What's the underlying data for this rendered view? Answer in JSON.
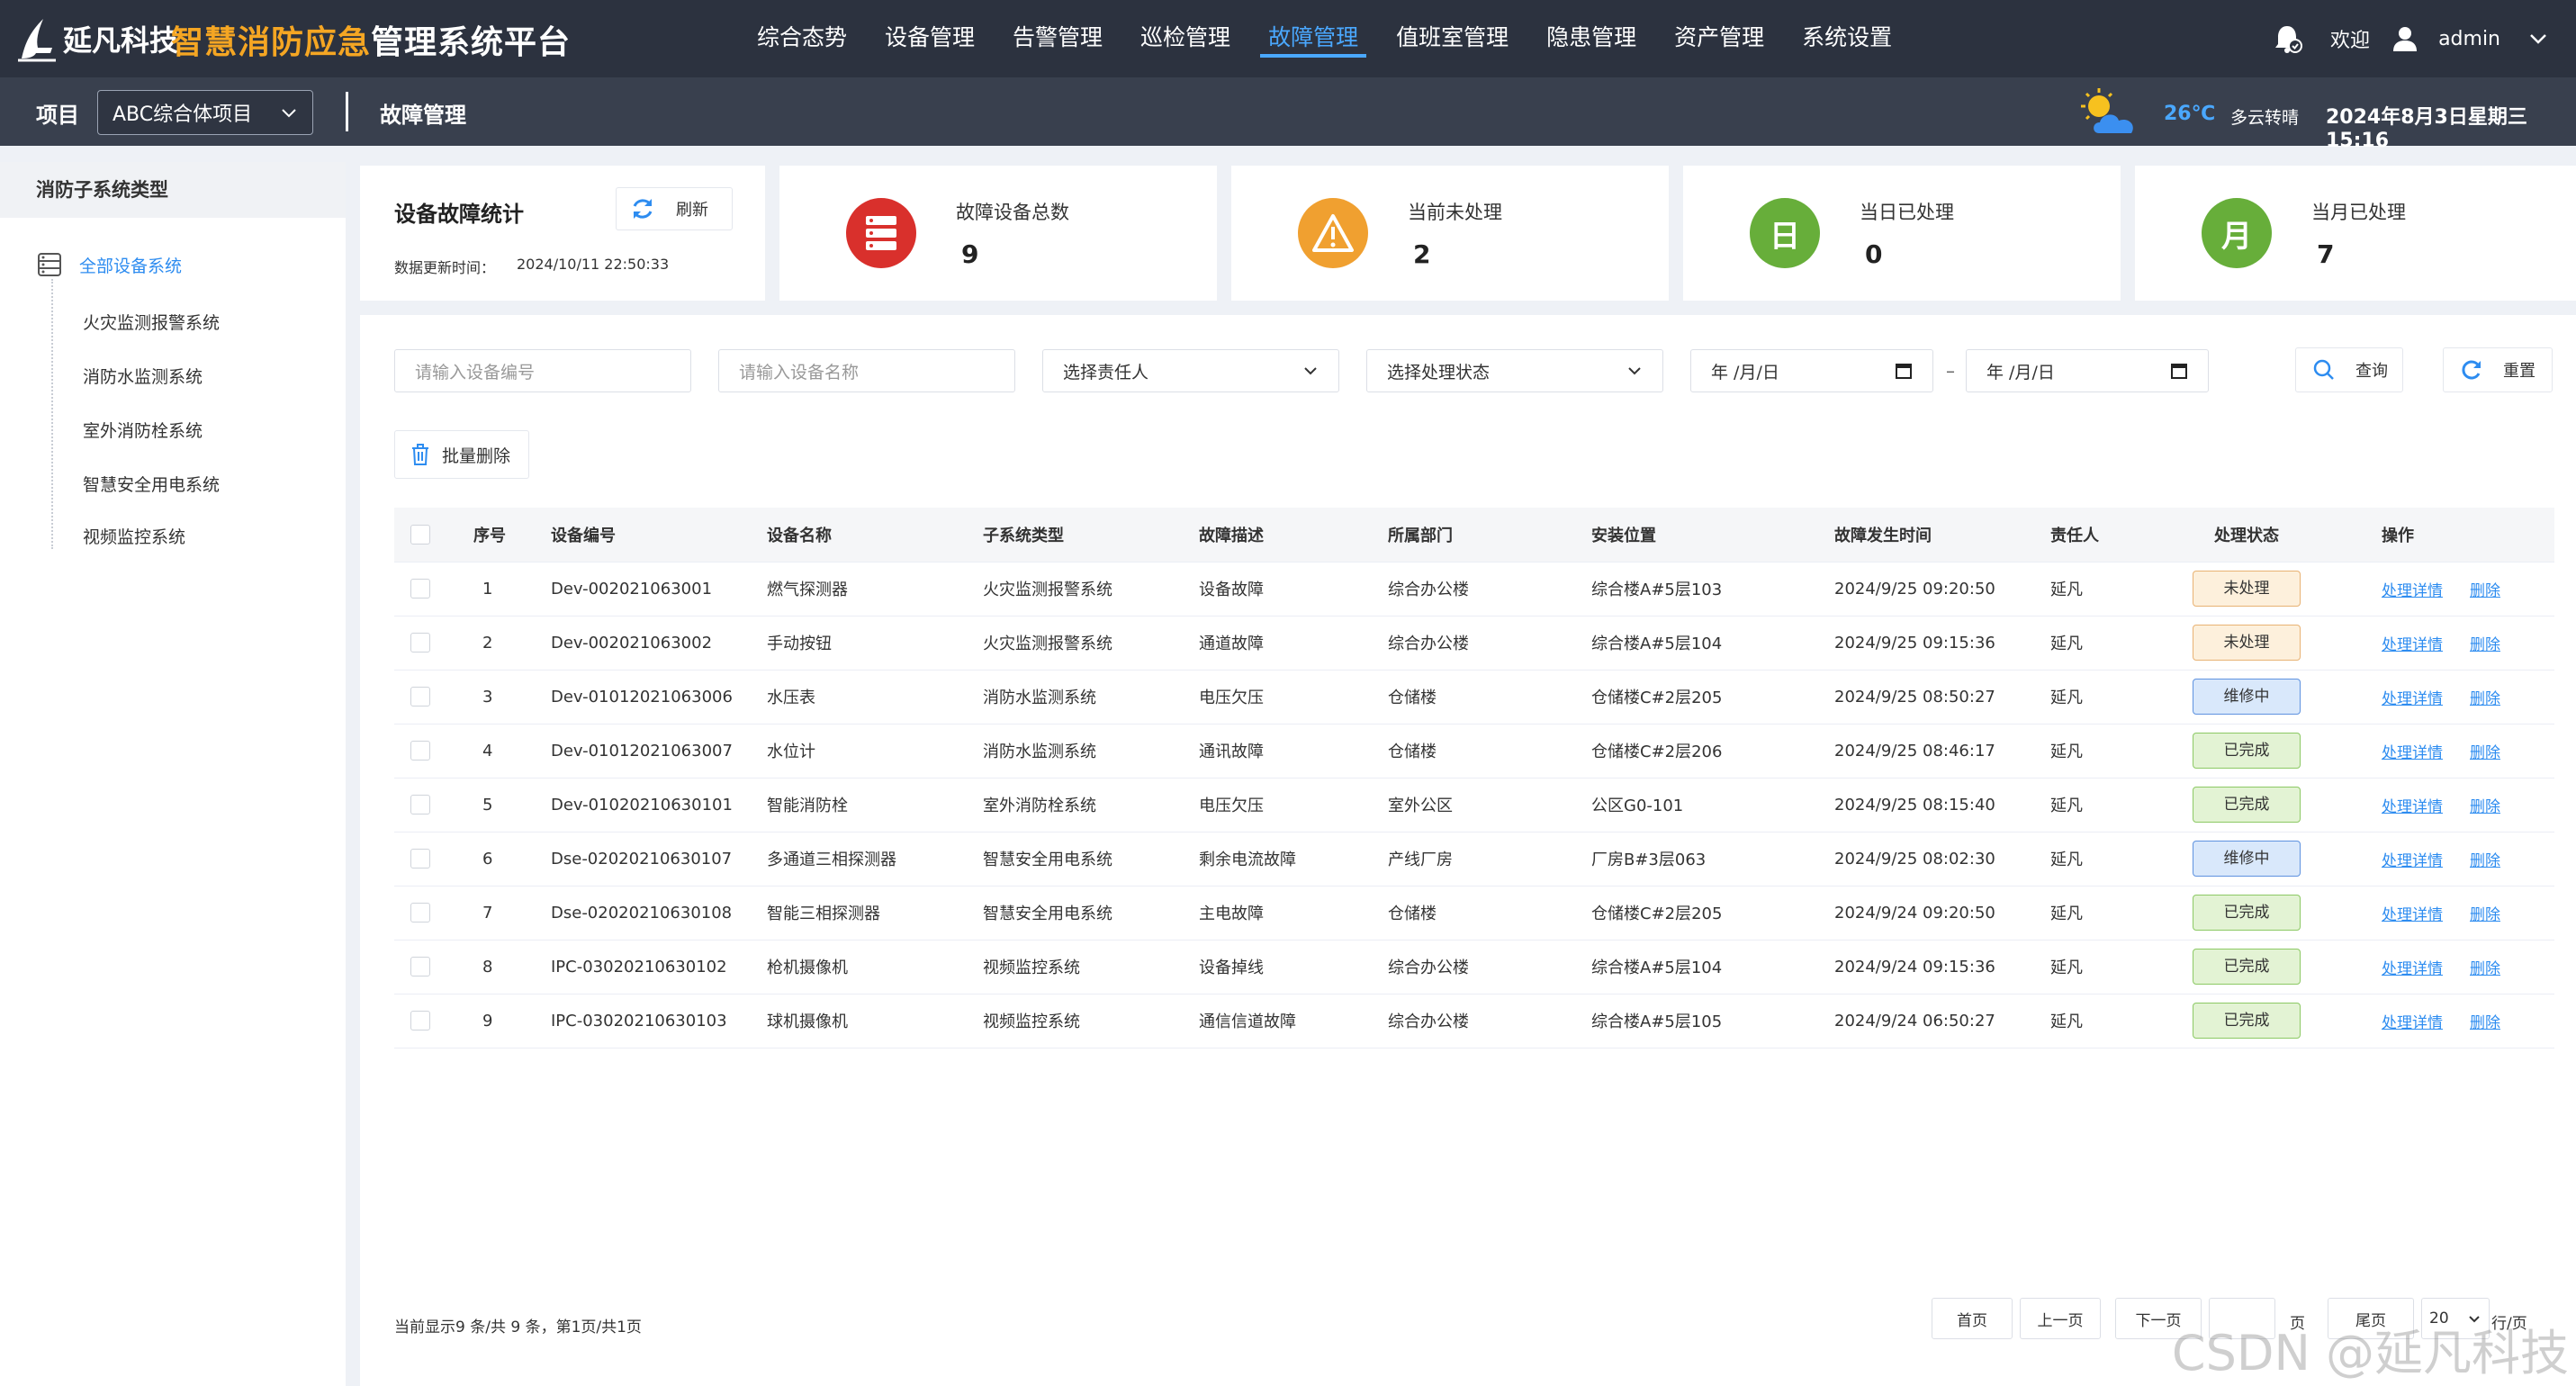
{
  "header": {
    "brand": "延凡科技",
    "system_title_highlight": "智慧消防应急",
    "system_title_rest": "管理系统平台",
    "nav": [
      "综合态势",
      "设备管理",
      "告警管理",
      "巡检管理",
      "故障管理",
      "值班室管理",
      "隐患管理",
      "资产管理",
      "系统设置"
    ],
    "active_nav": "故障管理",
    "welcome": "欢迎",
    "username": "admin"
  },
  "subbar": {
    "project_label": "项目",
    "project_value": "ABC综合体项目",
    "page_label": "故障管理",
    "temperature": "26℃",
    "weather": "多云转晴",
    "datetime": "2024年8月3日星期三 15:16"
  },
  "sidebar": {
    "title": "消防子系统类型",
    "root": "全部设备系统",
    "items": [
      "火灾监测报警系统",
      "消防水监测系统",
      "室外消防栓系统",
      "智慧安全用电系统",
      "视频监控系统"
    ]
  },
  "stats": {
    "title": "设备故障统计",
    "refresh_label": "刷新",
    "update_label": "数据更新时间：",
    "update_time": "2024/10/11 22:50:33",
    "cards": [
      {
        "label": "故障设备总数",
        "value": "9",
        "color": "#d9302c",
        "icon": "server-icon"
      },
      {
        "label": "当前未处理",
        "value": "2",
        "color": "#f0a030",
        "icon": "warning-icon"
      },
      {
        "label": "当日已处理",
        "value": "0",
        "color": "#67ae3a",
        "icon_text": "日"
      },
      {
        "label": "当月已处理",
        "value": "7",
        "color": "#67ae3a",
        "icon_text": "月"
      }
    ]
  },
  "filters": {
    "device_code_placeholder": "请输入设备编号",
    "device_name_placeholder": "请输入设备名称",
    "owner_select": "选择责任人",
    "status_select": "选择处理状态",
    "date_start": "年 /月/日",
    "date_end": "年 /月/日",
    "date_sep": "–",
    "query_label": "查询",
    "reset_label": "重置",
    "batch_delete_label": "批量删除"
  },
  "table": {
    "columns": [
      "序号",
      "设备编号",
      "设备名称",
      "子系统类型",
      "故障描述",
      "所属部门",
      "安装位置",
      "故障发生时间",
      "责任人",
      "处理状态",
      "操作"
    ],
    "detail_label": "处理详情",
    "delete_label": "删除",
    "rows": [
      {
        "no": "1",
        "code": "Dev-002021063001",
        "name": "燃气探测器",
        "subsystem": "火灾监测报警系统",
        "fault": "设备故障",
        "dept": "综合办公楼",
        "location": "综合楼A#5层103",
        "time": "2024/9/25 09:20:50",
        "owner": "延凡",
        "status": "未处理",
        "status_type": "pending"
      },
      {
        "no": "2",
        "code": "Dev-002021063002",
        "name": "手动按钮",
        "subsystem": "火灾监测报警系统",
        "fault": "通道故障",
        "dept": "综合办公楼",
        "location": "综合楼A#5层104",
        "time": "2024/9/25 09:15:36",
        "owner": "延凡",
        "status": "未处理",
        "status_type": "pending"
      },
      {
        "no": "3",
        "code": "Dev-01012021063006",
        "name": "水压表",
        "subsystem": "消防水监测系统",
        "fault": "电压欠压",
        "dept": "仓储楼",
        "location": "仓储楼C#2层205",
        "time": "2024/9/25 08:50:27",
        "owner": "延凡",
        "status": "维修中",
        "status_type": "repair"
      },
      {
        "no": "4",
        "code": "Dev-01012021063007",
        "name": "水位计",
        "subsystem": "消防水监测系统",
        "fault": "通讯故障",
        "dept": "仓储楼",
        "location": "仓储楼C#2层206",
        "time": "2024/9/25 08:46:17",
        "owner": "延凡",
        "status": "已完成",
        "status_type": "done"
      },
      {
        "no": "5",
        "code": "Dev-01020210630101",
        "name": "智能消防栓",
        "subsystem": "室外消防栓系统",
        "fault": "电压欠压",
        "dept": "室外公区",
        "location": "公区G0-101",
        "time": "2024/9/25 08:15:40",
        "owner": "延凡",
        "status": "已完成",
        "status_type": "done"
      },
      {
        "no": "6",
        "code": "Dse-02020210630107",
        "name": "多通道三相探测器",
        "subsystem": "智慧安全用电系统",
        "fault": "剩余电流故障",
        "dept": "产线厂房",
        "location": "厂房B#3层063",
        "time": "2024/9/25 08:02:30",
        "owner": "延凡",
        "status": "维修中",
        "status_type": "repair"
      },
      {
        "no": "7",
        "code": "Dse-02020210630108",
        "name": "智能三相探测器",
        "subsystem": "智慧安全用电系统",
        "fault": "主电故障",
        "dept": "仓储楼",
        "location": "仓储楼C#2层205",
        "time": "2024/9/24 09:20:50",
        "owner": "延凡",
        "status": "已完成",
        "status_type": "done"
      },
      {
        "no": "8",
        "code": "IPC-03020210630102",
        "name": "枪机摄像机",
        "subsystem": "视频监控系统",
        "fault": "设备掉线",
        "dept": "综合办公楼",
        "location": "综合楼A#5层104",
        "time": "2024/9/24 09:15:36",
        "owner": "延凡",
        "status": "已完成",
        "status_type": "done"
      },
      {
        "no": "9",
        "code": "IPC-03020210630103",
        "name": "球机摄像机",
        "subsystem": "视频监控系统",
        "fault": "通信信道故障",
        "dept": "综合办公楼",
        "location": "综合楼A#5层105",
        "time": "2024/9/24 06:50:27",
        "owner": "延凡",
        "status": "已完成",
        "status_type": "done"
      }
    ]
  },
  "pagination": {
    "info": "当前显示9 条/共 9 条，第1页/共1页",
    "first": "首页",
    "prev": "上一页",
    "next": "下一页",
    "page_unit": "页",
    "last": "尾页",
    "page_size": "20",
    "page_size_unit": "行/页"
  },
  "watermark": "CSDN @延凡科技"
}
